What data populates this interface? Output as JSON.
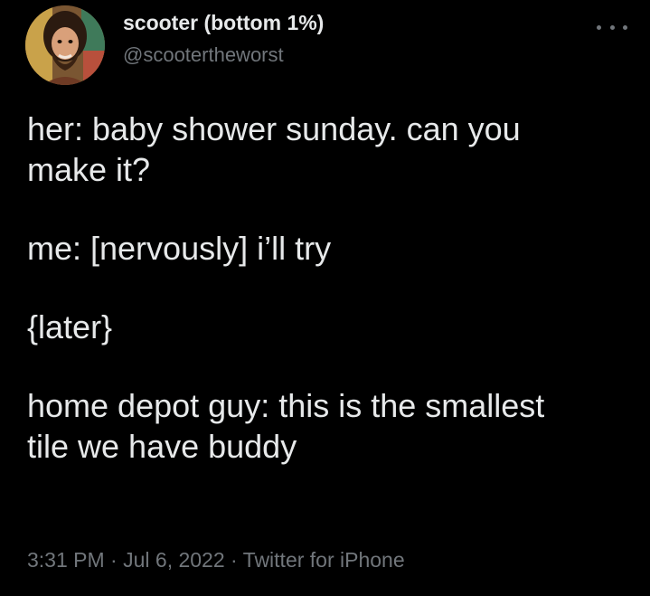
{
  "user": {
    "display_name": "scooter (bottom 1%)",
    "handle": "@scootertheworst",
    "avatar_icon": "profile-photo"
  },
  "menu": {
    "icon": "more-horizontal-icon"
  },
  "tweet": {
    "lines": [
      "her: baby shower sunday. can you",
      "make it?",
      "me: [nervously] i’ll try",
      "{later}",
      "home depot guy: this is the smallest",
      "tile we have buddy"
    ]
  },
  "meta": {
    "time": "3:31 PM",
    "separator": " · ",
    "date": "Jul 6, 2022",
    "source": "Twitter for iPhone"
  },
  "colors": {
    "background": "#000000",
    "text": "#e7e9ea",
    "secondary": "#71767b"
  }
}
